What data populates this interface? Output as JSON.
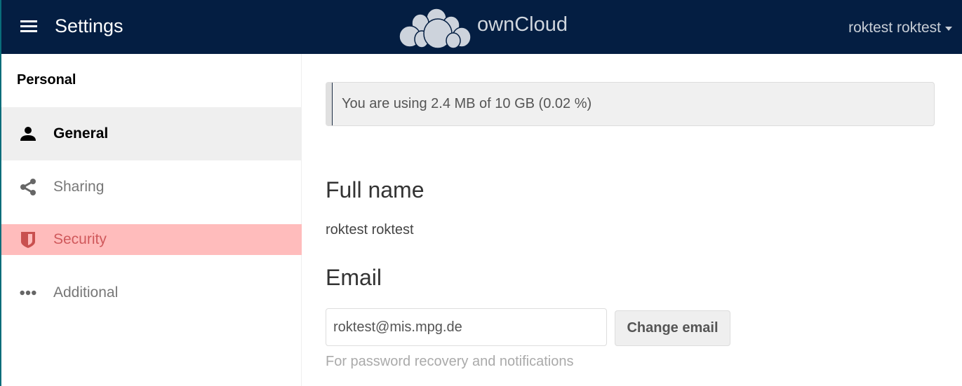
{
  "header": {
    "app_title": "Settings",
    "brand": "ownCloud",
    "user": "roktest roktest",
    "menu_icon": "hamburger-icon",
    "logo_icon": "owncloud-logo"
  },
  "sidebar": {
    "section": "Personal",
    "items": [
      {
        "label": "General",
        "icon": "user-icon",
        "state": "active"
      },
      {
        "label": "Sharing",
        "icon": "share-icon"
      },
      {
        "label": "Security",
        "icon": "shield-icon",
        "state": "highlighted"
      },
      {
        "label": "Additional",
        "icon": "more-icon"
      }
    ]
  },
  "main": {
    "quota": {
      "text": "You are using 2.4 MB of 10 GB (0.02 %)",
      "percent": 0.02
    },
    "fullname": {
      "heading": "Full name",
      "value": "roktest roktest"
    },
    "email": {
      "heading": "Email",
      "value": "roktest@mis.mpg.de",
      "button": "Change email",
      "hint": "For password recovery and notifications"
    }
  },
  "colors": {
    "header_bg": "#041e42",
    "active_bg": "#efefef",
    "security_bg": "#ffbcbc",
    "security_text": "#d0595c"
  }
}
